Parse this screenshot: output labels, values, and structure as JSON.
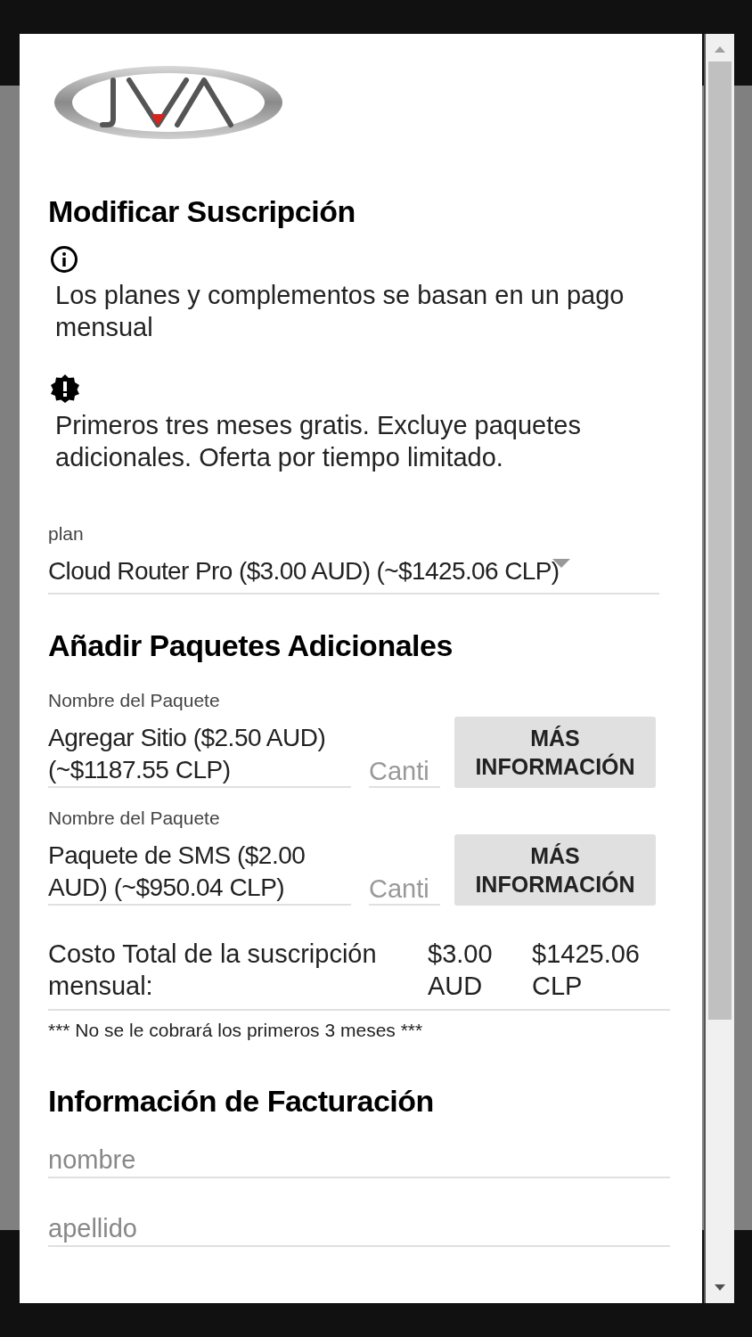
{
  "dialog": {
    "title": "Modificar Suscripción",
    "notices": [
      {
        "kind": "info",
        "text": "Los planes y complementos se basan en un pago mensual"
      },
      {
        "kind": "alert",
        "text": "Primeros tres meses gratis. Excluye paquetes adicionales. Oferta por tiempo limitado."
      }
    ],
    "plan": {
      "label": "plan",
      "value": "Cloud Router Pro ($3.00 AUD) (~$1425.06 CLP)"
    },
    "addons_title": "Añadir Paquetes Adicionales",
    "addons": [
      {
        "label": "Nombre del Paquete",
        "name": "Agregar Sitio ($2.50 AUD) (~$1187.55 CLP)",
        "quantity_placeholder": "Canti",
        "button": "MÁS INFORMACIÓN"
      },
      {
        "label": "Nombre del Paquete",
        "name": "Paquete de SMS ($2.00 AUD) (~$950.04 CLP)",
        "quantity_placeholder": "Canti",
        "button": "MÁS INFORMACIÓN"
      }
    ],
    "total": {
      "label": "Costo Total de la suscripción mensual:",
      "aud": "$3.00 AUD",
      "clp": "$1425.06 CLP"
    },
    "note": "*** No se le cobrará los primeros 3 meses ***",
    "billing_title": "Información de Facturación",
    "billing_fields": [
      {
        "placeholder": "nombre"
      },
      {
        "placeholder": "apellido"
      }
    ]
  }
}
